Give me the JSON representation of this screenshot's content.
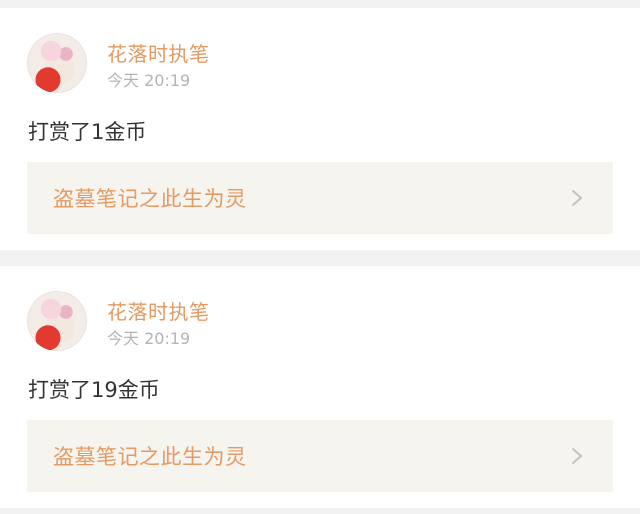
{
  "feed": {
    "items": [
      {
        "username": "花落时执笔",
        "time": "今天 20:19",
        "message": "打赏了1金币",
        "book_title": "盗墓笔记之此生为灵",
        "chevron_icon": "chevron-right-icon"
      },
      {
        "username": "花落时执笔",
        "time": "今天 20:19",
        "message": "打赏了19金币",
        "book_title": "盗墓笔记之此生为灵",
        "chevron_icon": "chevron-right-icon"
      }
    ]
  },
  "colors": {
    "accent": "#e49a63",
    "muted": "#b4b4b4",
    "text": "#333333",
    "link_bg": "#f6f4ef",
    "page_bg": "#f2f2f2"
  }
}
